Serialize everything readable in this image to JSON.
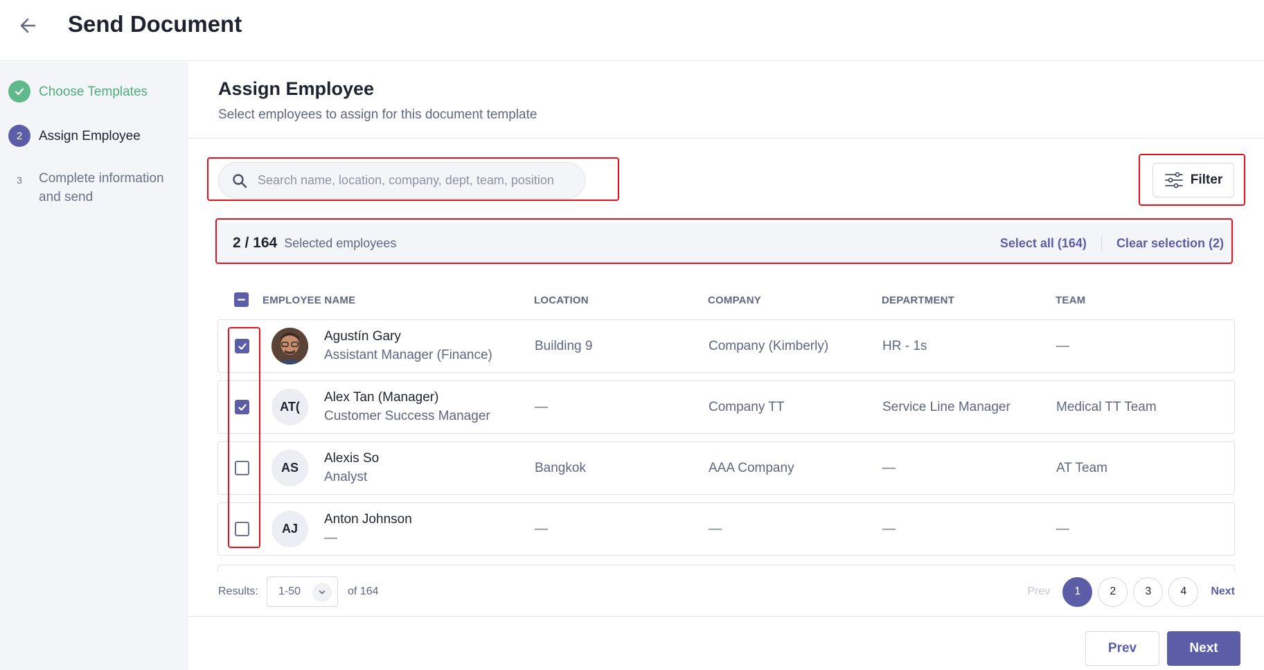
{
  "header": {
    "title": "Send Document",
    "back_icon": "arrow-left-icon"
  },
  "steps": [
    {
      "number": "",
      "label": "Choose Templates",
      "state": "done",
      "icon": "check-icon"
    },
    {
      "number": "2",
      "label": "Assign Employee",
      "state": "active"
    },
    {
      "number": "3",
      "label": "Complete information and send",
      "state": "pending"
    }
  ],
  "main": {
    "title": "Assign Employee",
    "subtitle": "Select employees to assign for this document template"
  },
  "search": {
    "placeholder": "Search name, location, company, dept, team, position",
    "value": "",
    "icon": "search-icon"
  },
  "filter": {
    "label": "Filter",
    "icon": "sliders-icon"
  },
  "selection": {
    "count": "2 / 164",
    "text": "Selected employees",
    "select_all": "Select all (164)",
    "clear": "Clear selection (2)"
  },
  "table": {
    "columns": [
      "EMPLOYEE NAME",
      "LOCATION",
      "COMPANY",
      "DEPARTMENT",
      "TEAM"
    ],
    "header_checkbox": "indeterminate",
    "rows": [
      {
        "checked": true,
        "initials": "",
        "has_photo": true,
        "name": "Agustín Gary",
        "position": "Assistant Manager (Finance)",
        "location": "Building 9",
        "company": "Company (Kimberly)",
        "department": "HR - 1s",
        "team": "—"
      },
      {
        "checked": true,
        "initials": "AT(",
        "has_photo": false,
        "name": "Alex Tan (Manager)",
        "position": "Customer Success Manager",
        "location": "—",
        "company": "Company TT",
        "department": "Service Line Manager",
        "team": "Medical TT Team"
      },
      {
        "checked": false,
        "initials": "AS",
        "has_photo": false,
        "name": "Alexis So",
        "position": "Analyst",
        "location": "Bangkok",
        "company": "AAA Company",
        "department": "—",
        "team": "AT Team"
      },
      {
        "checked": false,
        "initials": "AJ",
        "has_photo": false,
        "name": "Anton Johnson",
        "position": "—",
        "location": "—",
        "company": "—",
        "department": "—",
        "team": "—"
      }
    ]
  },
  "pagination": {
    "results_label": "Results:",
    "page_size": "1-50",
    "of_text": "of 164",
    "prev": "Prev",
    "pages": [
      "1",
      "2",
      "3",
      "4"
    ],
    "current_page": "1",
    "next": "Next"
  },
  "footer": {
    "prev": "Prev",
    "next": "Next"
  },
  "colors": {
    "accent": "#5b5ea6",
    "success": "#5fb98a",
    "annotation": "#e3111f"
  }
}
